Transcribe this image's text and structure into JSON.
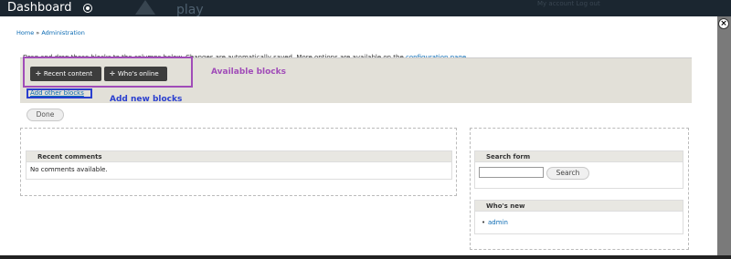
{
  "header": {
    "title": "Dashboard",
    "ghost_text": "play",
    "ghost_links": "My account   Log out"
  },
  "breadcrumb": {
    "home": "Home",
    "separator": "»",
    "current": "Administration"
  },
  "intro": {
    "text": "Drag and drop these blocks to the columns below. Changes are automatically saved. More options are available on the ",
    "link": "configuration page",
    "suffix": "."
  },
  "available_blocks": [
    {
      "label": "Recent content"
    },
    {
      "label": "Who's online"
    }
  ],
  "annotations": {
    "available": "Available blocks",
    "add_new": "Add new blocks",
    "purple": "#a04cb8",
    "blue": "#2a3fcf"
  },
  "add_link": "Add other blocks",
  "done_label": "Done",
  "left_column": {
    "recent_comments": {
      "title": "Recent comments",
      "body": "No comments available."
    }
  },
  "right_column": {
    "search_form": {
      "title": "Search form",
      "button": "Search",
      "value": ""
    },
    "whos_new": {
      "title": "Who's new",
      "items": [
        "admin"
      ]
    }
  },
  "close_icon": "close-icon",
  "colors": {
    "link": "#0a6ab3",
    "header_bg": "#1b2630",
    "region_bg": "#e2e0d8",
    "block_btn": "#3d3d3d"
  }
}
